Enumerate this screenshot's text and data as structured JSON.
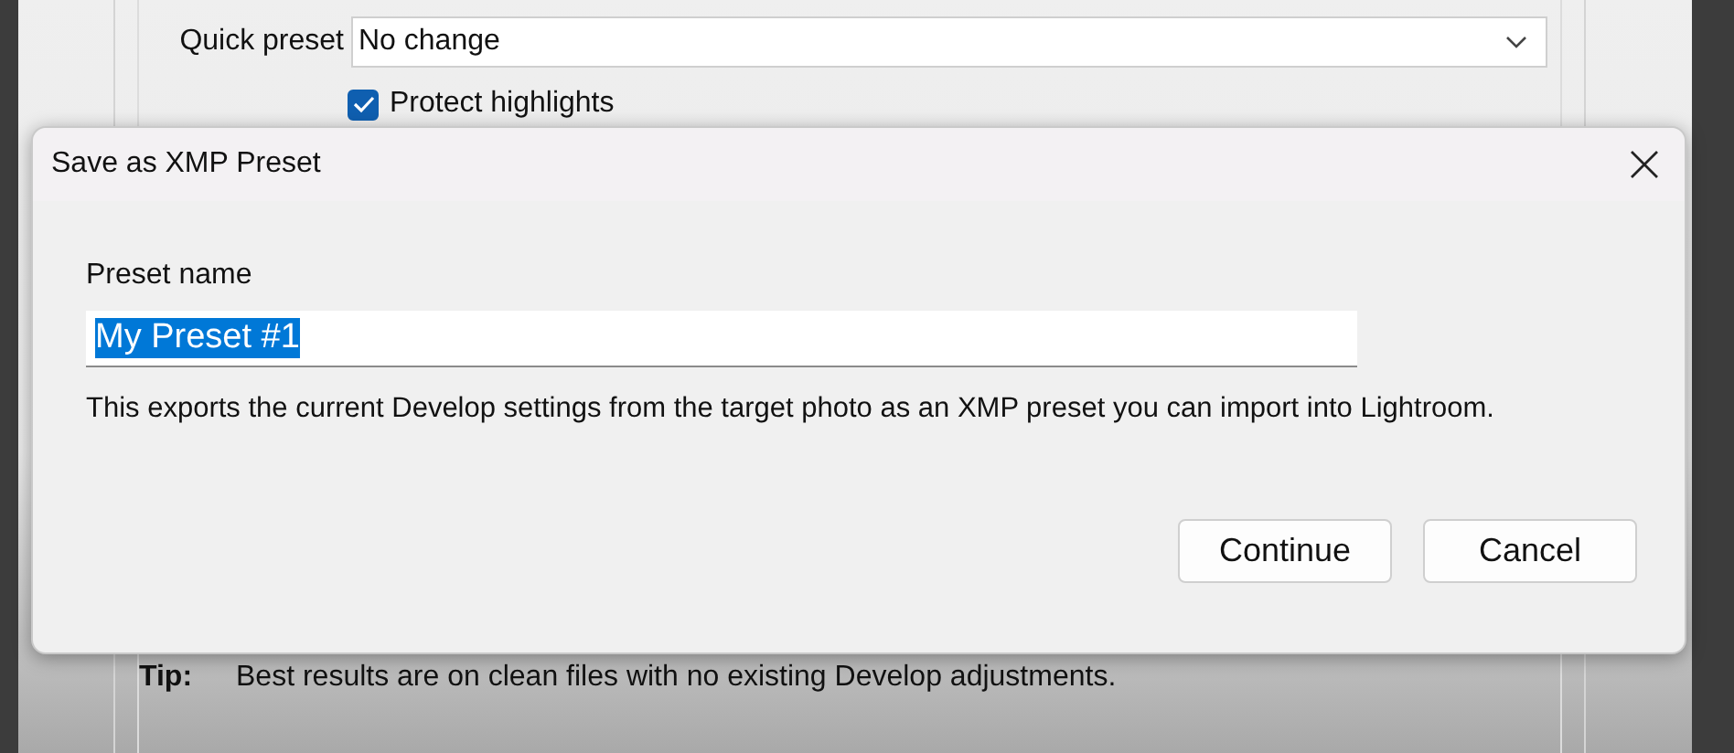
{
  "background_window": {
    "quick_preset": {
      "label": "Quick preset",
      "value": "No change"
    },
    "protect_highlights": {
      "label": "Protect highlights",
      "checked": true
    },
    "tip": {
      "label": "Tip:",
      "text": "Best results are on clean files with no existing Develop adjustments."
    }
  },
  "dialog": {
    "title": "Save as XMP Preset",
    "field": {
      "label": "Preset name",
      "value": "My Preset #1",
      "text_selected": true
    },
    "description": "This exports the current Develop settings from the target photo as an XMP preset you can import into Lightroom.",
    "buttons": [
      "Continue",
      "Cancel"
    ]
  }
}
